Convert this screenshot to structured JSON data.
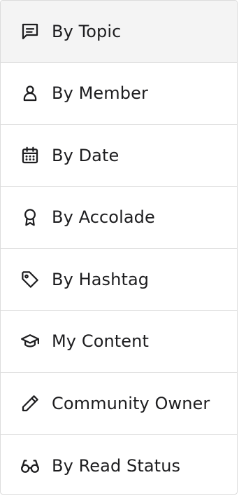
{
  "menu": {
    "items": [
      {
        "label": "By Topic",
        "icon": "chat-icon",
        "active": true
      },
      {
        "label": "By Member",
        "icon": "person-icon",
        "active": false
      },
      {
        "label": "By Date",
        "icon": "calendar-icon",
        "active": false
      },
      {
        "label": "By Accolade",
        "icon": "award-ribbon-icon",
        "active": false
      },
      {
        "label": "By Hashtag",
        "icon": "tag-icon",
        "active": false
      },
      {
        "label": "My Content",
        "icon": "graduation-cap-icon",
        "active": false
      },
      {
        "label": "Community Owner",
        "icon": "pencil-icon",
        "active": false
      },
      {
        "label": "By Read Status",
        "icon": "glasses-icon",
        "active": false
      }
    ]
  },
  "colors": {
    "text": "#1d1d1f",
    "active_background": "#f4f4f4",
    "divider": "#dcdcdc"
  }
}
